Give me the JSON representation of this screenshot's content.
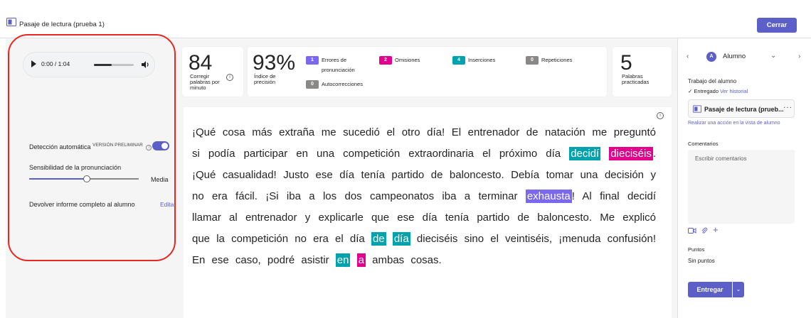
{
  "header": {
    "title": "Pasaje de lectura (prueba 1)",
    "close_label": "Cerrar"
  },
  "audio": {
    "time": "0:00 / 1:04",
    "progress": 0.45
  },
  "settings": {
    "auto_detect_label": "Detección automática",
    "preview_tag": "VERSIÓN PRELIMINAR",
    "auto_detect_on": true,
    "sensitivity_label": "Sensibilidad de la pronunciación",
    "sensitivity_value": "Media",
    "sensitivity_level": 0.5,
    "report_label": "Devolver informe completo al alumno",
    "edit_label": "Editar"
  },
  "stats": {
    "wcpm": {
      "value": "84",
      "label": [
        "Corregir",
        "palabras por",
        "minuto"
      ]
    },
    "accuracy": {
      "value": "93%",
      "label": [
        "Índice de",
        "precisión"
      ]
    },
    "errors": [
      {
        "count": "1",
        "label": [
          "Errores de",
          "pronunciación"
        ],
        "color": "#7b68ee"
      },
      {
        "count": "2",
        "label": [
          "Omisiones"
        ],
        "color": "#e3008c"
      },
      {
        "count": "4",
        "label": [
          "Inserciones"
        ],
        "color": "#00a2ad"
      },
      {
        "count": "0",
        "label": [
          "Repeticiones"
        ],
        "color": "#8a8886"
      },
      {
        "count": "0",
        "label": [
          "Autocorrecciones"
        ],
        "color": "#8a8886"
      }
    ],
    "words": {
      "value": "5",
      "label": [
        "Palabras",
        "practicadas"
      ]
    }
  },
  "reading": {
    "segments": [
      {
        "t": "¡Qué cosa más extraña me sucedió el otro día! El entrenador de natación me preguntó si podía participar en una competición extraordinaria el próximo día "
      },
      {
        "t": "decidí",
        "hl": "teal"
      },
      {
        "t": " "
      },
      {
        "t": "dieciséis",
        "hl": "pink"
      },
      {
        "t": ". ¡Qué casualidad! Justo ese día tenía partido de baloncesto. Debía tomar una decisión y no era fácil. ¡Si iba a los dos campeonatos iba a terminar "
      },
      {
        "t": "exhausta",
        "hl": "purple"
      },
      {
        "t": "! Al final decidí llamar al entrenador y explicarle que ese día tenía partido de baloncesto. Me explicó que la competición no era el día "
      },
      {
        "t": "de",
        "hl": "teal"
      },
      {
        "t": " "
      },
      {
        "t": "día",
        "hl": "teal"
      },
      {
        "t": " dieciséis sino el veintiséis, ¡menuda confusión! En ese caso, podré asistir "
      },
      {
        "t": "en",
        "hl": "teal"
      },
      {
        "t": " "
      },
      {
        "t": "a",
        "hl": "pink"
      },
      {
        "t": " ambas cosas."
      }
    ]
  },
  "sidebar": {
    "student_initial": "A",
    "student_name": "Alumno",
    "work_title": "Trabajo del alumno",
    "status": "Entregado",
    "history_link": "Ver historial",
    "attachment": "Pasaje de lectura (prueb...",
    "action_link": "Realizar una acción en la vista de alumno",
    "comments_title": "Comentarios",
    "comments_placeholder": "Escribir comentarios",
    "points_title": "Puntos",
    "points_value": "Sin puntos",
    "turn_in_label": "Entregar"
  }
}
